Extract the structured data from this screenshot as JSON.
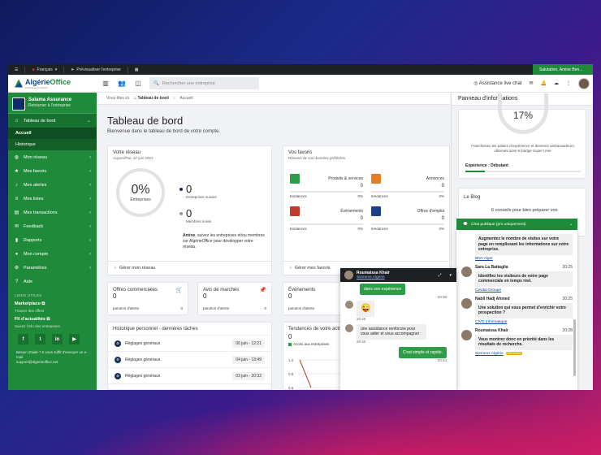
{
  "topbar": {
    "language": "Français",
    "preview": "Prévisualiser l'entreprise",
    "greeting": "Salutation, Amine Ben..."
  },
  "header": {
    "logo_main": "Algérie",
    "logo_accent": "Office",
    "logo_tag": "Professional network",
    "search_placeholder": "Rechercher une entreprise",
    "live_chat": "Assistance live chat"
  },
  "company": {
    "name": "Salama Assurance",
    "back": "Retourner à l'entreprise"
  },
  "sidebar": {
    "items": [
      {
        "label": "Tableau de bord",
        "icon": "home-icon",
        "glyph": "⌂"
      },
      {
        "label": "Mon réseau",
        "icon": "globe-icon",
        "glyph": "◍"
      },
      {
        "label": "Mes favoris",
        "icon": "star-icon",
        "glyph": "★"
      },
      {
        "label": "Mes alertes",
        "icon": "bell-icon",
        "glyph": "♪"
      },
      {
        "label": "Mes listes",
        "icon": "list-icon",
        "glyph": "≡"
      },
      {
        "label": "Mes transactions",
        "icon": "transactions-icon",
        "glyph": "▤"
      },
      {
        "label": "Feedback",
        "icon": "chat-icon",
        "glyph": "✉"
      },
      {
        "label": "Rapports",
        "icon": "chart-icon",
        "glyph": "▮"
      },
      {
        "label": "Mon compte",
        "icon": "user-icon",
        "glyph": "●"
      },
      {
        "label": "Paramètres",
        "icon": "gear-icon",
        "glyph": "⚙"
      },
      {
        "label": "Aide",
        "icon": "help-icon",
        "glyph": "?"
      }
    ],
    "sub": [
      "Accueil",
      "Historique"
    ],
    "links_head": "LIENS UTILES",
    "marketplace": "Marketplace",
    "marketplace_sub": "Trouver des offres",
    "fil": "Fil d'actualités",
    "fil_sub": "Suivez l'info des entreprises",
    "help_text": "Besoin d'aide ? Il vous suffit d'envoyer un e-mail.",
    "email": "support@algerieoffice.net"
  },
  "breadcrumb": {
    "prefix": "Vous êtes ici",
    "page": "Tableau de bord",
    "current": "Accueil"
  },
  "page": {
    "title": "Tableau de bord",
    "subtitle": "Bienvenue dans le tableau de bord de votre compte."
  },
  "network": {
    "title": "Votre réseau",
    "date": "Aujourd'hui, 12 juin 2021",
    "pct": "0%",
    "pct_label": "Entreprises",
    "followed": "0",
    "followed_label": "Entreprises suivies",
    "members": "0",
    "members_label": "Membres suivis",
    "cta_name": "Amine",
    "cta_text": ", suivez les entreprises et/ou membres sur AlgérieOffice pour développer votre réseau.",
    "footer": "Gérer mon réseau"
  },
  "favorites": {
    "title": "Vos favoris",
    "subtitle": "Résumé de vos données préférées.",
    "items": [
      {
        "label": "Produits & services",
        "value": "0",
        "trend": "tendances",
        "pct": "0%",
        "color": "#2e9e46"
      },
      {
        "label": "Annonces",
        "value": "0",
        "trend": "tendances",
        "pct": "0%",
        "color": "#e67e22"
      },
      {
        "label": "Événements",
        "value": "0",
        "trend": "tendances",
        "pct": "0%",
        "color": "#c0392b"
      },
      {
        "label": "Offres d'emploi",
        "value": "0",
        "trend": "tendances",
        "pct": "0%",
        "color": "#1c3f8c"
      }
    ],
    "footer": "Gérer mes favoris"
  },
  "minis": [
    {
      "title": "Offres commerciales",
      "value": "0",
      "sub": "parution d'alerte",
      "count": "0",
      "icon": "basket-icon",
      "glyph": "🛒"
    },
    {
      "title": "Avis de marchés",
      "value": "0",
      "sub": "parution d'alerte",
      "count": "0",
      "icon": "pin-icon",
      "glyph": "📌"
    },
    {
      "title": "Événements",
      "value": "0",
      "sub": "parution d'alerte",
      "count": "0",
      "icon": "calendar-icon",
      "glyph": ""
    }
  ],
  "history": {
    "title": "Historique personnel - dernières tâches",
    "tasks": [
      {
        "name": "Réglages généraux",
        "time": "06 juin - 12:21"
      },
      {
        "name": "Réglages généraux",
        "time": "04 juin - 13:49"
      },
      {
        "name": "Réglages généraux",
        "time": "03 juin - 20:32"
      }
    ]
  },
  "trends": {
    "title": "Tendances de votre activité",
    "value": "0",
    "label": "Accès aux entreprises",
    "yticks": [
      "1.0",
      "0.8",
      "0.6"
    ],
    "series_color": "#c0392b"
  },
  "chart_data": {
    "type": "line",
    "title": "Tendances de votre activité",
    "yticks": [
      "1.0",
      "0.8",
      "0.6"
    ],
    "ylim": [
      0.6,
      1.0
    ],
    "series": [
      {
        "name": "Accès aux entreprises",
        "values": [
          1.0,
          0.6
        ]
      }
    ]
  },
  "right": {
    "title": "Panneau d'informations",
    "pct": "17%",
    "level_text": "Franchissez les paliers d'expérience et devenez ambassadeurs, obtenant ainsi le badge Super User.",
    "level_label": "Expérience : Débutant",
    "level_fraction": 0.17,
    "blog_title": "Le Blog",
    "blog_text": "6 conseils pour bien préparer vos"
  },
  "public_chat": {
    "title": "Chat publique (pro uniquement)",
    "messages": [
      {
        "name": "",
        "time": "",
        "text": "Augmentez le nombre de visites sur votre page en remplissant les informations sur votre entreprise.",
        "company": "BNA Alger",
        "badge": ""
      },
      {
        "name": "Sara La Battaglia",
        "time": "20:25",
        "text": "Identifiez les visiteurs de votre page commerciale en temps réel.",
        "company": "Cevital Groupe",
        "badge": ""
      },
      {
        "name": "Nabil Hadj Ahmed",
        "time": "20:25",
        "text": "Une solution qui vous permet d'enrichir votre prospection ?",
        "company": "CIVD Informatique",
        "badge": ""
      },
      {
        "name": "Roumaissa Khair",
        "time": "20:28",
        "text": "Vous montrez donc en priorité dans les résultats de recherche.",
        "company": "Siemens Algérie",
        "badge": "PREMIUM"
      }
    ]
  },
  "private_chat": {
    "name": "Roumaissa Khair",
    "company": "Siemens Algérie",
    "m1": "dans son expérience",
    "t1": "20:38",
    "emoji": "😜",
    "t2": "20:40",
    "m3": "une assistance renforcée pour vous aider et vous accompagner",
    "t3": "20:40",
    "m4": "C'est simple et rapide.",
    "t4": "20:44"
  }
}
